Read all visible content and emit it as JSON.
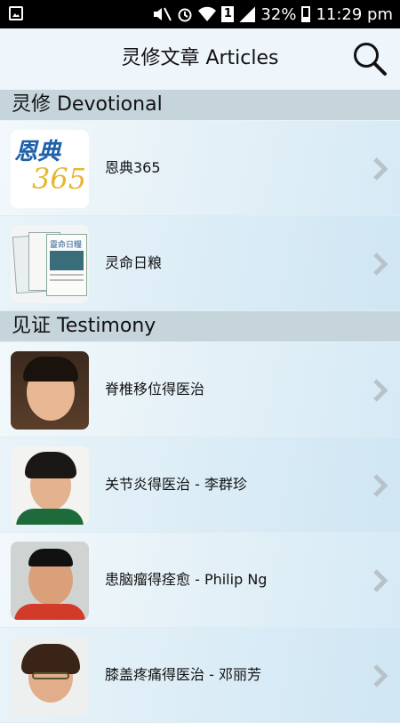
{
  "status_bar": {
    "battery": "32%",
    "time": "11:29 pm",
    "sim": "1"
  },
  "header": {
    "title": "灵修文章 Articles"
  },
  "sections": [
    {
      "title": "灵修 Devotional"
    },
    {
      "title": "见证 Testimony"
    }
  ],
  "devotional_items": [
    {
      "label": "恩典365",
      "thumb_text_top": "恩典",
      "thumb_text_num": "365"
    },
    {
      "label": "灵命日粮",
      "thumb_text": "靈命日糧"
    }
  ],
  "testimony_items": [
    {
      "label": "脊椎移位得医治"
    },
    {
      "label": "关节炎得医治 - 李群珍"
    },
    {
      "label": "患脑瘤得痊愈 - Philip Ng"
    },
    {
      "label": "膝盖疼痛得医治 - 邓丽芳"
    }
  ],
  "colors": {
    "accent_blue": "#2a73b5",
    "section_bg": "#c6d5dc",
    "header_bg": "#eef5fb"
  }
}
